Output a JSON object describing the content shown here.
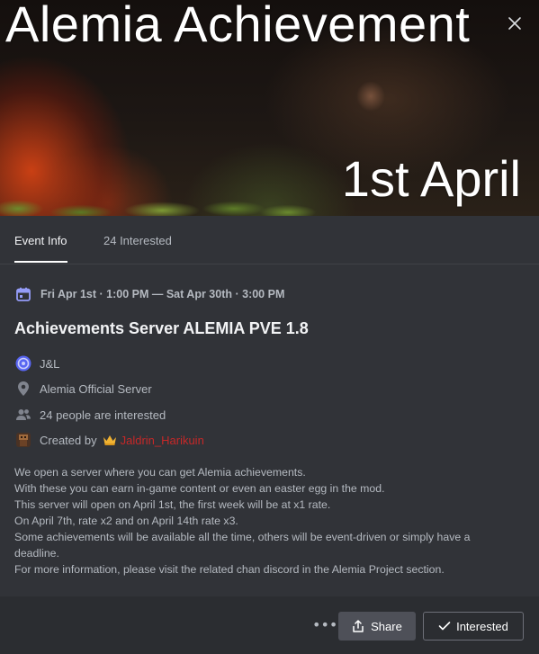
{
  "banner": {
    "title": "Alemia Achievement",
    "subtitle": "1st April"
  },
  "tabs": [
    {
      "label": "Event Info",
      "active": true
    },
    {
      "label": "24 Interested",
      "active": false
    }
  ],
  "event": {
    "date_range": "Fri Apr 1st · 1:00 PM — Sat Apr 30th · 3:00 PM",
    "title": "Achievements Server ALEMIA PVE 1.8",
    "host": "J&L",
    "location": "Alemia Official Server",
    "interested": "24 people are interested",
    "created_by_label": "Created by",
    "creator": "Jaldrin_Harikuin",
    "description": [
      "We open a server where you can get Alemia achievements.",
      "With these you can earn in-game content or even an easter egg in the mod.",
      "This server will open on April 1st, the first week will be at x1 rate.",
      "On April 7th, rate x2 and on April 14th rate x3.",
      "Some achievements will be available all the time, others will be event-driven or simply have a",
      "deadline.",
      "For more information, please visit the related chan discord in the Alemia Project section."
    ]
  },
  "footer": {
    "more_label": "•••",
    "share_label": "Share",
    "interested_label": "Interested"
  },
  "icons": {
    "close": "close-icon",
    "calendar": "calendar-icon",
    "host": "server-icon",
    "location": "location-pin-icon",
    "people": "people-icon",
    "creator": "creator-avatar-icon",
    "crown": "crown-icon",
    "share": "share-icon",
    "check": "check-icon"
  },
  "colors": {
    "background": "#313338",
    "footer": "#2b2d31",
    "creator_name": "#c62828",
    "calendar": "#949cf7",
    "accent_button": "#4e5058"
  }
}
